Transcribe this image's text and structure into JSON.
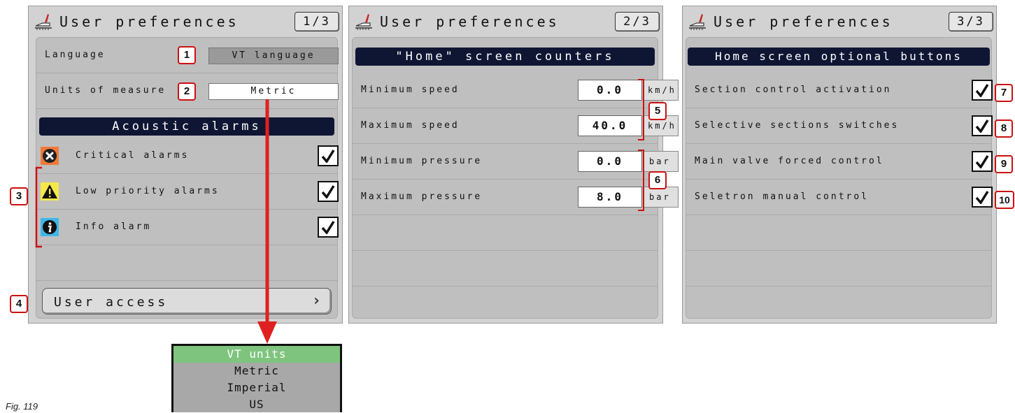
{
  "panel1": {
    "title": "User preferences",
    "page": "1/3",
    "language_label": "Language",
    "language_value": "VT language",
    "units_label": "Units of measure",
    "units_value": "Metric",
    "alarms_banner": "Acoustic alarms",
    "alarms": [
      {
        "label": "Critical alarms",
        "icon": "critical-alarm-icon",
        "checked": true
      },
      {
        "label": "Low priority alarms",
        "icon": "warning-icon",
        "checked": true
      },
      {
        "label": "Info alarm",
        "icon": "info-icon",
        "checked": true
      }
    ],
    "user_access_label": "User access"
  },
  "panel2": {
    "title": "User preferences",
    "page": "2/3",
    "banner": "\"Home\" screen counters",
    "rows": [
      {
        "label": "Minimum speed",
        "value": "0.0",
        "unit": "km/h"
      },
      {
        "label": "Maximum speed",
        "value": "40.0",
        "unit": "km/h"
      },
      {
        "label": "Minimum pressure",
        "value": "0.0",
        "unit": "bar"
      },
      {
        "label": "Maximum pressure",
        "value": "8.0",
        "unit": "bar"
      }
    ]
  },
  "panel3": {
    "title": "User preferences",
    "page": "3/3",
    "banner": "Home screen optional buttons",
    "rows": [
      {
        "label": "Section control activation",
        "checked": true
      },
      {
        "label": "Selective sections switches",
        "checked": true
      },
      {
        "label": "Main valve forced control",
        "checked": true
      },
      {
        "label": "Seletron manual control",
        "checked": true
      }
    ]
  },
  "callouts": [
    "1",
    "2",
    "3",
    "4",
    "5",
    "6",
    "7",
    "8",
    "9",
    "10"
  ],
  "units_dropdown": {
    "options": [
      "VT units",
      "Metric",
      "Imperial",
      "US"
    ],
    "selected": "VT units"
  },
  "figure_caption": "Fig. 119",
  "colors": {
    "banner_bg": "#0f1634",
    "callout_border": "#cc1111",
    "arrow": "#e02020",
    "selected_option": "#7ec47e"
  }
}
